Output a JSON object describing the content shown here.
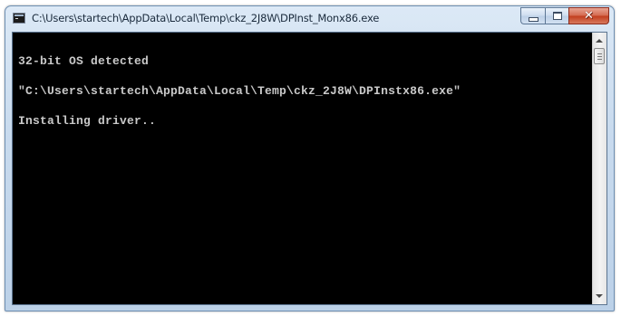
{
  "window": {
    "title": "C:\\Users\\startech\\AppData\\Local\\Temp\\ckz_2J8W\\DPInst_Monx86.exe",
    "app_icon": "console-window-icon",
    "caption_buttons": {
      "minimize_icon": "minimize-icon",
      "maximize_icon": "maximize-icon",
      "close_icon": "close-icon",
      "close_glyph": "✕"
    }
  },
  "console": {
    "lines": [
      "32-bit OS detected",
      "\"C:\\Users\\startech\\AppData\\Local\\Temp\\ckz_2J8W\\DPInstx86.exe\"",
      "Installing driver.."
    ],
    "background": "#000000",
    "text_color": "#c0c0c0"
  },
  "scrollbar": {
    "up_icon": "scroll-up-arrow-icon",
    "down_icon": "scroll-down-arrow-icon"
  }
}
